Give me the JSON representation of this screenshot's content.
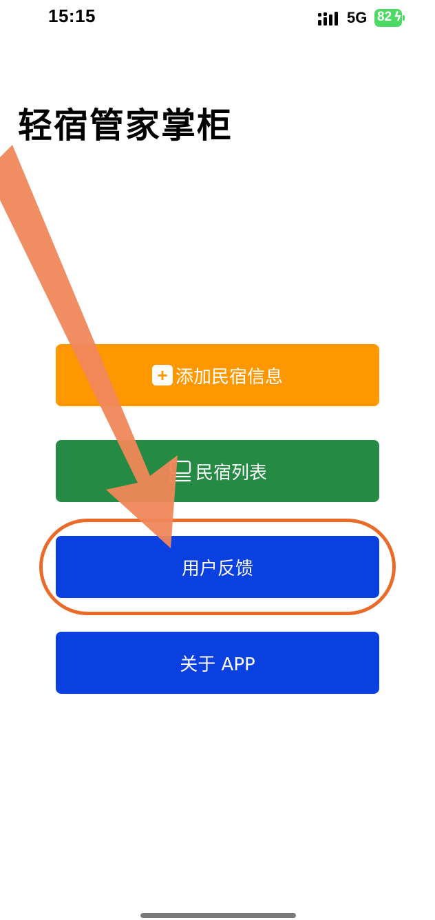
{
  "status_bar": {
    "time": "15:15",
    "network": "5G",
    "battery_level": "82",
    "signal_icon": "signal-bars-icon",
    "battery_icon": "battery-charging-icon"
  },
  "title": "轻宿管家掌柜",
  "buttons": {
    "add": {
      "label": "添加民宿信息",
      "icon": "plus-square-icon",
      "color": "#ff9800"
    },
    "list": {
      "label": "民宿列表",
      "icon": "list-icon",
      "color": "#258a43"
    },
    "feedback": {
      "label": "用户反馈",
      "color": "#0a3fe0"
    },
    "about": {
      "label": "关于 APP",
      "color": "#0a3fe0"
    }
  },
  "annotation": {
    "arrow_color": "#f0875a",
    "ring_color": "#ea6a2a"
  }
}
